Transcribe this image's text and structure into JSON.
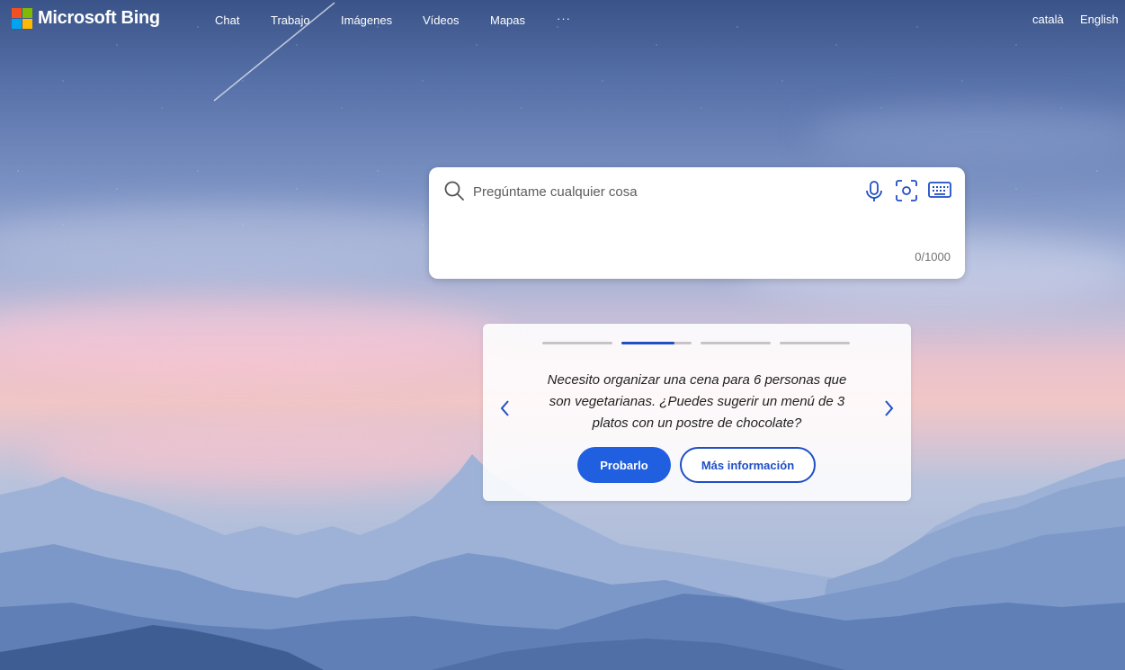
{
  "brand": {
    "name": "Microsoft Bing",
    "logo_colors": [
      "#f25022",
      "#7fba00",
      "#00a4ef",
      "#ffb900"
    ]
  },
  "nav": {
    "items": [
      "Chat",
      "Trabajo",
      "Imágenes",
      "Vídeos",
      "Mapas",
      "···"
    ]
  },
  "languages": [
    "català",
    "English"
  ],
  "search": {
    "placeholder": "Pregúntame cualquier cosa",
    "value": "",
    "counter": "0/1000",
    "icons": [
      "search-icon",
      "microphone-icon",
      "visual-search-icon",
      "keyboard-icon"
    ]
  },
  "suggestion": {
    "active_index": 1,
    "total": 4,
    "active_progress": 0.75,
    "prompt": "Necesito organizar una cena para 6 personas que son vegetarianas. ¿Puedes sugerir un menú de 3 platos con un postre de chocolate?",
    "primary_button": "Probarlo",
    "secondary_button": "Más información"
  },
  "colors": {
    "accent": "#1f5fe0",
    "accent_dark": "#1f4fc5"
  }
}
